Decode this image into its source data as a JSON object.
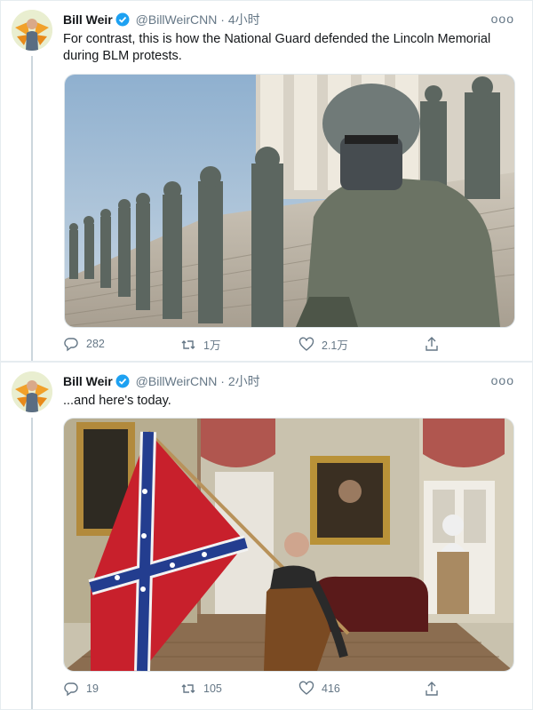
{
  "tweets": [
    {
      "author_name": "Bill Weir",
      "handle": "@BillWeirCNN",
      "separator": "·",
      "time": "4小时",
      "more": "ooo",
      "text": "For contrast, this is how the National Guard defended the Lincoln Memorial during BLM protests.",
      "media_description": "photo",
      "replies": "282",
      "retweets": "1万",
      "likes": "2.1万"
    },
    {
      "author_name": "Bill Weir",
      "handle": "@BillWeirCNN",
      "separator": "·",
      "time": "2小时",
      "more": "ooo",
      "text": "...and here's today.",
      "media_description": "photo",
      "replies": "19",
      "retweets": "105",
      "likes": "416"
    }
  ],
  "colors": {
    "text_primary": "#14171a",
    "text_secondary": "#657786",
    "verified": "#1da1f2",
    "background": "#e6ecf0"
  },
  "icons": [
    "verified-badge-icon",
    "more-icon",
    "reply-icon",
    "retweet-icon",
    "like-icon",
    "share-icon"
  ]
}
